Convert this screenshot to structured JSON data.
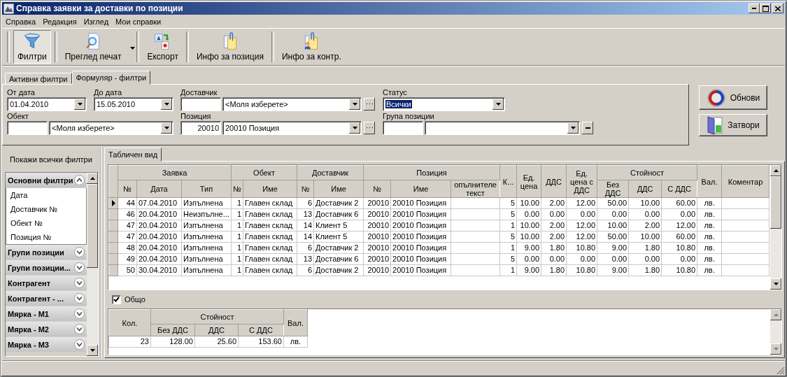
{
  "window": {
    "title": "Справка заявки за доставки по позиции"
  },
  "menu": [
    "Справка",
    "Редакция",
    "Изглед",
    "Мои справки"
  ],
  "toolbar": [
    {
      "label": "Филтри",
      "kind": "funnel",
      "pressed": true,
      "dropdown": false
    },
    {
      "label": "Преглед печат",
      "kind": "preview",
      "pressed": false,
      "dropdown": true
    },
    {
      "label": "Експорт",
      "kind": "export",
      "pressed": false,
      "dropdown": false
    },
    {
      "label": "Инфо за позиция",
      "kind": "info",
      "pressed": false,
      "dropdown": false
    },
    {
      "label": "Инфо за контр.",
      "kind": "contact",
      "pressed": false,
      "dropdown": false
    }
  ],
  "tabs": [
    {
      "label": "Активни филтри",
      "selected": false
    },
    {
      "label": "Формуляр - филтри",
      "selected": true
    }
  ],
  "filters": {
    "from_date": {
      "label": "От дата",
      "value": "01.04.2010"
    },
    "to_date": {
      "label": "До дата",
      "value": "15.05.2010"
    },
    "supplier": {
      "label": "Доставчик",
      "value": "<Моля изберете>"
    },
    "status": {
      "label": "Статус",
      "value": "Всички",
      "highlighted": true
    },
    "object": {
      "label": "Обект",
      "value": "<Моля изберете>"
    },
    "position": {
      "label": "Позиция",
      "code": "20010",
      "value": "20010 Позиция"
    },
    "position_group": {
      "label": "Група позиции"
    }
  },
  "actions": [
    {
      "label": "Обнови",
      "kind": "refresh"
    },
    {
      "label": "Затвори",
      "kind": "exit"
    }
  ],
  "sidebar": {
    "show_all": "Покажи всички филтри",
    "groups": [
      {
        "label": "Основни филтри",
        "expanded": true,
        "children": [
          {
            "label": "Дата"
          },
          {
            "label": "Доставчик №"
          },
          {
            "label": "Обект №"
          },
          {
            "label": "Позиция №"
          }
        ]
      },
      {
        "label": "Групи позиции",
        "expanded": false
      },
      {
        "label": "Групи позиции...",
        "expanded": false
      },
      {
        "label": "Контрагент",
        "expanded": false
      },
      {
        "label": "Контрагент - ...",
        "expanded": false
      },
      {
        "label": "Мярка - М1",
        "expanded": false
      },
      {
        "label": "Мярка - М2",
        "expanded": false
      },
      {
        "label": "Мярка - М3",
        "expanded": false
      }
    ]
  },
  "view_tabs": [
    {
      "label": "Табличен вид",
      "selected": true
    }
  ],
  "table": {
    "header": [
      {
        "label": "Заявка",
        "columns": [
          "№",
          "Дата",
          "Тип"
        ]
      },
      {
        "label": "Обект",
        "columns": [
          "№",
          "Име"
        ]
      },
      {
        "label": "Доставчик",
        "columns": [
          "№",
          "Име"
        ]
      },
      {
        "label": "Позиция",
        "columns": [
          "№",
          "Име",
          "опълнителе текст"
        ]
      },
      {
        "label": "К..."
      },
      {
        "label": "Ед. цена"
      },
      {
        "label": "ДДС"
      },
      {
        "label": "Ед. цена с ДДС"
      },
      {
        "label": "Стойност",
        "columns": [
          "Без ДДС",
          "ДДС",
          "С ДДС"
        ]
      },
      {
        "label": "Вал."
      },
      {
        "label": "Коментар"
      }
    ],
    "rows": [
      {
        "selected": true,
        "cells": [
          "44",
          "07.04.2010",
          "Изпълнена",
          "1",
          "Главен склад",
          "6",
          "Доставчик 2",
          "20010",
          "20010 Позиция",
          null,
          "5",
          "10.00",
          "2.00",
          "12.00",
          "50.00",
          "10.00",
          "60.00",
          "лв.",
          null
        ]
      },
      {
        "selected": false,
        "cells": [
          "46",
          "20.04.2010",
          "Неизпълне...",
          "1",
          "Главен склад",
          "13",
          "Доставчик 6",
          "20010",
          "20010 Позиция",
          null,
          "5",
          "0.00",
          "0.00",
          "0.00",
          "0.00",
          "0.00",
          "0.00",
          "лв.",
          null
        ]
      },
      {
        "selected": false,
        "cells": [
          "47",
          "20.04.2010",
          "Изпълнена",
          "1",
          "Главен склад",
          "14",
          "Клиент 5",
          "20010",
          "20010 Позиция",
          null,
          "1",
          "10.00",
          "2.00",
          "12.00",
          "10.00",
          "2.00",
          "12.00",
          "лв.",
          null
        ]
      },
      {
        "selected": false,
        "cells": [
          "47",
          "20.04.2010",
          "Изпълнена",
          "1",
          "Главен склад",
          "14",
          "Клиент 5",
          "20010",
          "20010 Позиция",
          null,
          "5",
          "10.00",
          "2.00",
          "12.00",
          "50.00",
          "10.00",
          "60.00",
          "лв.",
          null
        ]
      },
      {
        "selected": false,
        "cells": [
          "48",
          "20.04.2010",
          "Изпълнена",
          "1",
          "Главен склад",
          "6",
          "Доставчик 2",
          "20010",
          "20010 Позиция",
          null,
          "1",
          "9.00",
          "1.80",
          "10.80",
          "9.00",
          "1.80",
          "10.80",
          "лв.",
          null
        ]
      },
      {
        "selected": false,
        "cells": [
          "49",
          "20.04.2010",
          "Изпълнена",
          "1",
          "Главен склад",
          "13",
          "Доставчик 6",
          "20010",
          "20010 Позиция",
          null,
          "5",
          "0.00",
          "0.00",
          "0.00",
          "0.00",
          "0.00",
          "0.00",
          "лв.",
          null
        ]
      },
      {
        "selected": false,
        "cells": [
          "50",
          "30.04.2010",
          "Изпълнена",
          "1",
          "Главен склад",
          "6",
          "Доставчик 2",
          "20010",
          "20010 Позиция",
          null,
          "1",
          "9.00",
          "1.80",
          "10.80",
          "9.00",
          "1.80",
          "10.80",
          "лв.",
          null
        ]
      }
    ]
  },
  "totals": {
    "checkbox": {
      "label": "Общо",
      "checked": true
    },
    "header": [
      {
        "label": "Кол."
      },
      {
        "label": "Стойност",
        "columns": [
          "Без ДДС",
          "ДДС",
          "С ДДС"
        ]
      },
      {
        "label": "Вал."
      }
    ],
    "rows": [
      [
        "23",
        "128.00",
        "25.60",
        "153.60",
        "лв."
      ]
    ]
  }
}
